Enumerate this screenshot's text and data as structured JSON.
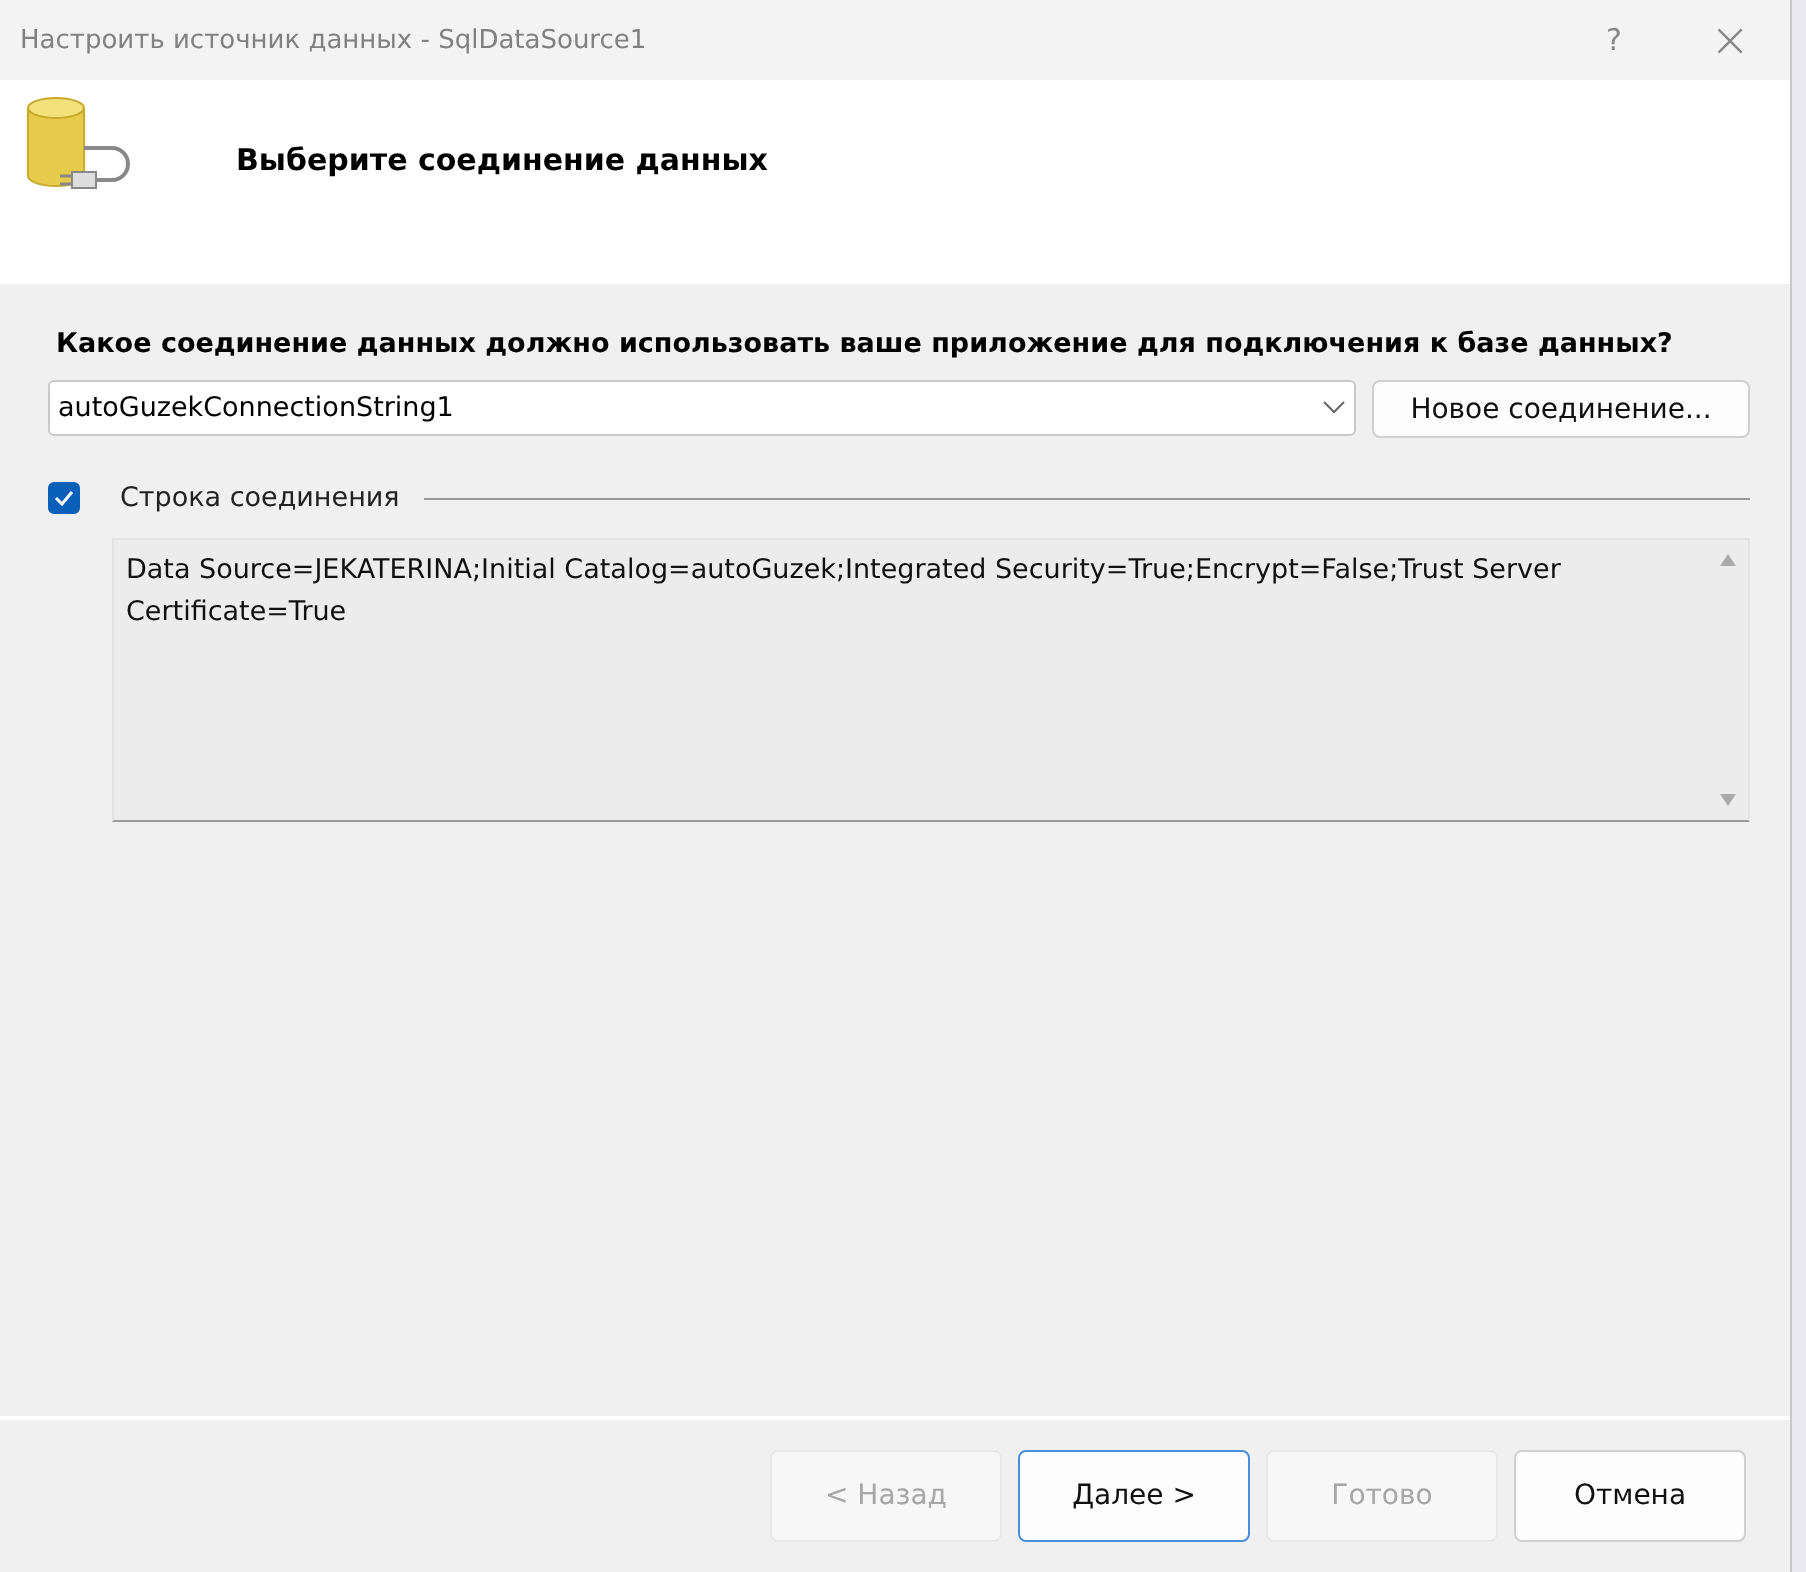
{
  "window": {
    "title": "Настроить источник данных - SqlDataSource1",
    "help": "?",
    "close": "×"
  },
  "header": {
    "title": "Выберите соединение данных"
  },
  "question": "Какое соединение данных должно использовать ваше приложение для подключения к базе данных?",
  "connection_select": {
    "value": "autoGuzekConnectionString1"
  },
  "new_connection_button": "Новое соединение...",
  "connection_string": {
    "label": "Строка соединения",
    "checked": true,
    "value": "Data Source=JEKATERINA;Initial Catalog=autoGuzek;Integrated Security=True;Encrypt=False;Trust Server Certificate=True"
  },
  "buttons": [
    {
      "label": "< Назад",
      "disabled": true,
      "default": false
    },
    {
      "label": "Далее >",
      "disabled": false,
      "default": true
    },
    {
      "label": "Готово",
      "disabled": true,
      "default": false
    },
    {
      "label": "Отмена",
      "disabled": false,
      "default": false
    }
  ]
}
